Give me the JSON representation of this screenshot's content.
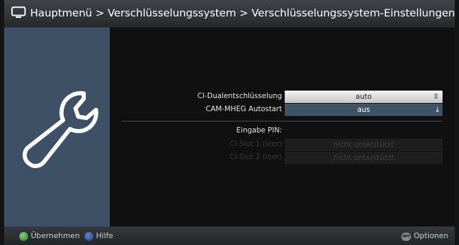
{
  "title_bar": {
    "icon": "tv-icon",
    "breadcrumb": "Hauptmenü > Verschlüsselungssystem > Verschlüsselungssystem-Einstellungen"
  },
  "left_panel": {
    "icon": "wrench-icon"
  },
  "settings": {
    "ci_dual": {
      "label": "CI-Dualentschlüsselung",
      "value": "auto"
    },
    "cam_mheg": {
      "label": "CAM-MHEG Autostart",
      "value": "aus"
    },
    "pin_heading": "Eingabe PIN:",
    "slot1": {
      "label": "CI-Slot 1 (leer)",
      "value": "nicht unterstützt"
    },
    "slot2": {
      "label": "CI-Slot 2 (leer)",
      "value": "nicht unterstützt"
    }
  },
  "bottom_bar": {
    "green_label": "Übernehmen",
    "blue_label": "Hilfe",
    "opt_key_text": "OPT",
    "options_label": "Optionen"
  },
  "colors": {
    "panel": "#3d5066",
    "selected": "#e0e0e0",
    "green_key": "#3fa03a",
    "blue_key": "#2f5496"
  }
}
